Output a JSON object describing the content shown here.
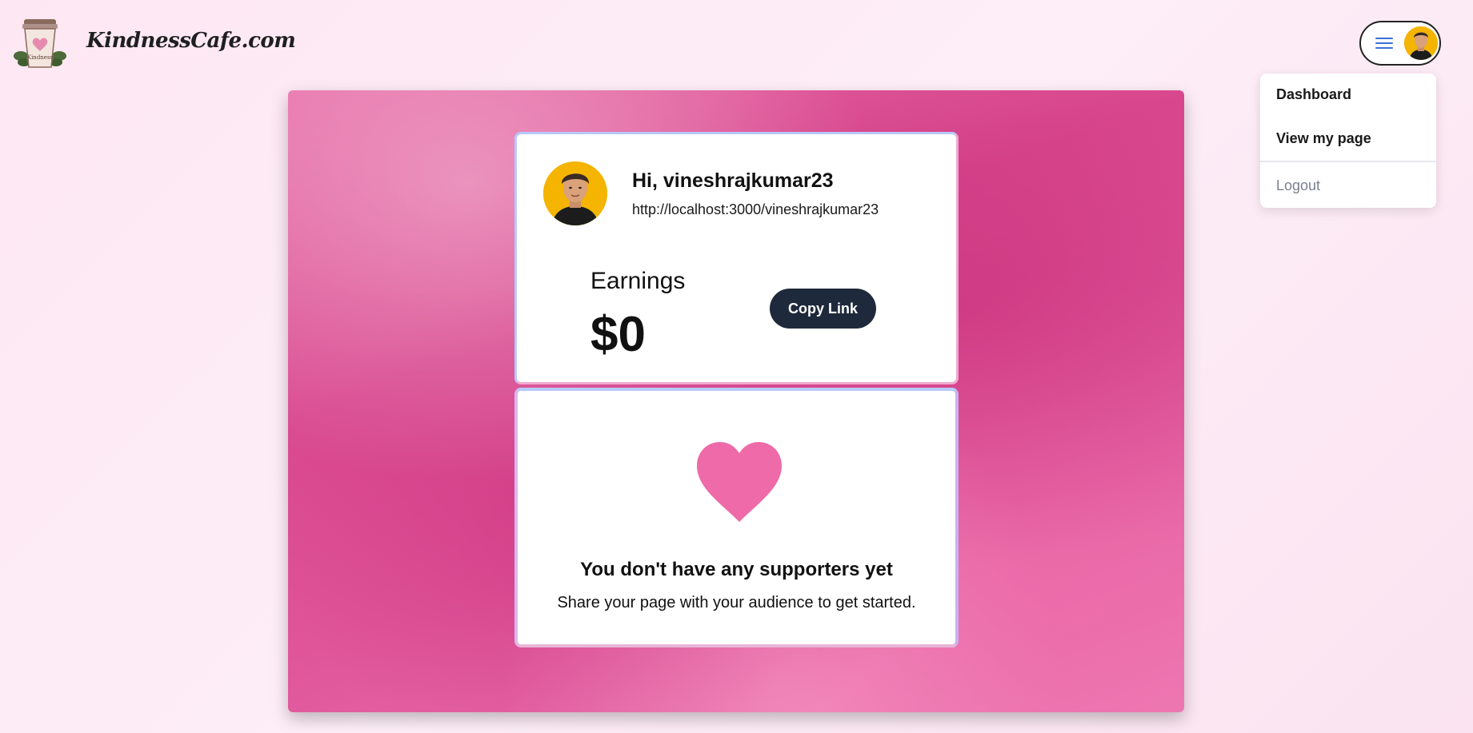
{
  "header": {
    "brand": "KindnessCafe.com",
    "logo_icon": "coffee-cup-heart-icon"
  },
  "user_menu": {
    "menu_icon": "hamburger-icon",
    "avatar_icon": "user-avatar",
    "items": {
      "dashboard": "Dashboard",
      "view_page": "View my page",
      "logout": "Logout"
    }
  },
  "profile": {
    "greeting": "Hi, vineshrajkumar23",
    "url": "http://localhost:3000/vineshrajkumar23"
  },
  "earnings": {
    "label": "Earnings",
    "value": "$0",
    "copy_button": "Copy Link"
  },
  "supporters": {
    "icon": "heart-icon",
    "title": "You don't have any supporters yet",
    "subtitle": "Share your page with your audience to get started."
  },
  "colors": {
    "accent_pink": "#ee6aa8",
    "button_dark": "#1e293b",
    "hamburger_blue": "#3b6fd6",
    "avatar_yellow": "#f4b400"
  }
}
